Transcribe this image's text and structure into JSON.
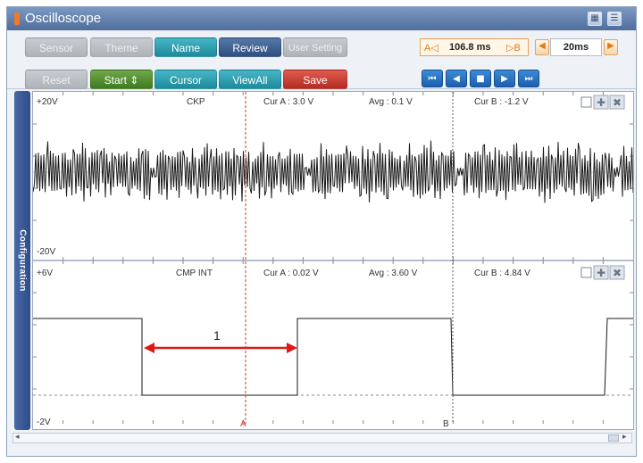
{
  "window": {
    "title": "Oscilloscope"
  },
  "titlebar": {
    "export_icon": "export-icon",
    "menu_icon": "menu-icon"
  },
  "toolbar": {
    "row1": [
      {
        "label": "Sensor",
        "style": "gray",
        "enabled": false
      },
      {
        "label": "Theme",
        "style": "gray",
        "enabled": false
      },
      {
        "label": "Name",
        "style": "teal",
        "enabled": true
      },
      {
        "label": "Review",
        "style": "navy",
        "enabled": true
      },
      {
        "label": "User Setting",
        "style": "gray",
        "enabled": false
      }
    ],
    "row2": [
      {
        "label": "Reset",
        "style": "gray",
        "enabled": false
      },
      {
        "label": "Start ⇕",
        "style": "green",
        "enabled": true
      },
      {
        "label": "Cursor",
        "style": "teal",
        "enabled": true
      },
      {
        "label": "ViewAll",
        "style": "teal",
        "enabled": true
      },
      {
        "label": "Save",
        "style": "red",
        "enabled": true
      }
    ],
    "cursor_readout": {
      "left_label": "A◁",
      "value": "106.8 ms",
      "right_label": "▷B"
    },
    "timebase": {
      "value": "20ms"
    },
    "playback": [
      "first",
      "prev",
      "stop",
      "next",
      "last"
    ]
  },
  "sidebar": {
    "label": "Configuration"
  },
  "channels": [
    {
      "name": "CKP",
      "ymax_label": "+20V",
      "ymin_label": "-20V",
      "cur_a": "Cur A : 3.0 V",
      "avg": "Avg : 0.1 V",
      "cur_b": "Cur B : -1.2 V"
    },
    {
      "name": "CMP INT",
      "ymax_label": "+6V",
      "ymin_label": "-2V",
      "cur_a": "Cur A : 0.02 V",
      "avg": "Avg : 3.60 V",
      "cur_b": "Cur B : 4.84 V"
    }
  ],
  "cursors": {
    "a_label": "A",
    "b_label": "B"
  },
  "annotation": {
    "label": "1"
  },
  "colors": {
    "cursor_a": "#e03030",
    "cursor_b": "#555555",
    "trace": "#1a1a1a",
    "arrow": "#e01818"
  }
}
